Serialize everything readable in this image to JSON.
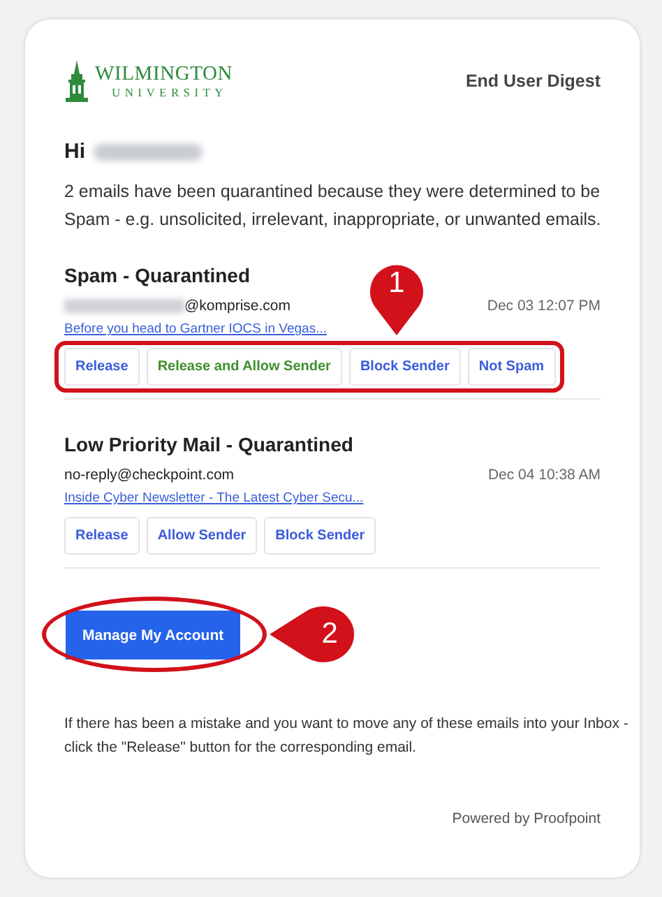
{
  "header": {
    "logo_line_1": "WILMINGTON",
    "logo_line_2": "UNIVERSITY",
    "title": "End User Digest"
  },
  "greeting": "Hi",
  "intro": "2 emails have been quarantined because they were determined to be Spam - e.g. unsolicited, irrelevant, inappropriate, or unwanted emails.",
  "sections": [
    {
      "title": "Spam - Quarantined",
      "sender_redacted": true,
      "sender": "@komprise.com",
      "date": "Dec 03 12:07 PM",
      "subject": "Before you head to Gartner IOCS in Vegas...",
      "annotation": "1",
      "buttons": [
        {
          "label": "Release",
          "color": "#3b5bdb"
        },
        {
          "label": "Release and Allow Sender",
          "color": "#3f8f2c"
        },
        {
          "label": "Block Sender",
          "color": "#3b5bdb"
        },
        {
          "label": "Not Spam",
          "color": "#3b5bdb"
        }
      ]
    },
    {
      "title": "Low Priority Mail - Quarantined",
      "sender_redacted": false,
      "sender": "no-reply@checkpoint.com",
      "date": "Dec 04 10:38 AM",
      "subject": "Inside Cyber Newsletter - The Latest Cyber Secu...",
      "buttons": [
        {
          "label": "Release",
          "color": "#3b5bdb"
        },
        {
          "label": "Allow Sender",
          "color": "#3b5bdb"
        },
        {
          "label": "Block Sender",
          "color": "#3b5bdb"
        }
      ]
    }
  ],
  "manage_button": {
    "label": "Manage My Account",
    "annotation": "2"
  },
  "footer_note": "If there has been a mistake and you want to move any of these emails into your Inbox - click the \"Release\" button for the corresponding email.",
  "powered_by": "Powered by Proofpoint"
}
